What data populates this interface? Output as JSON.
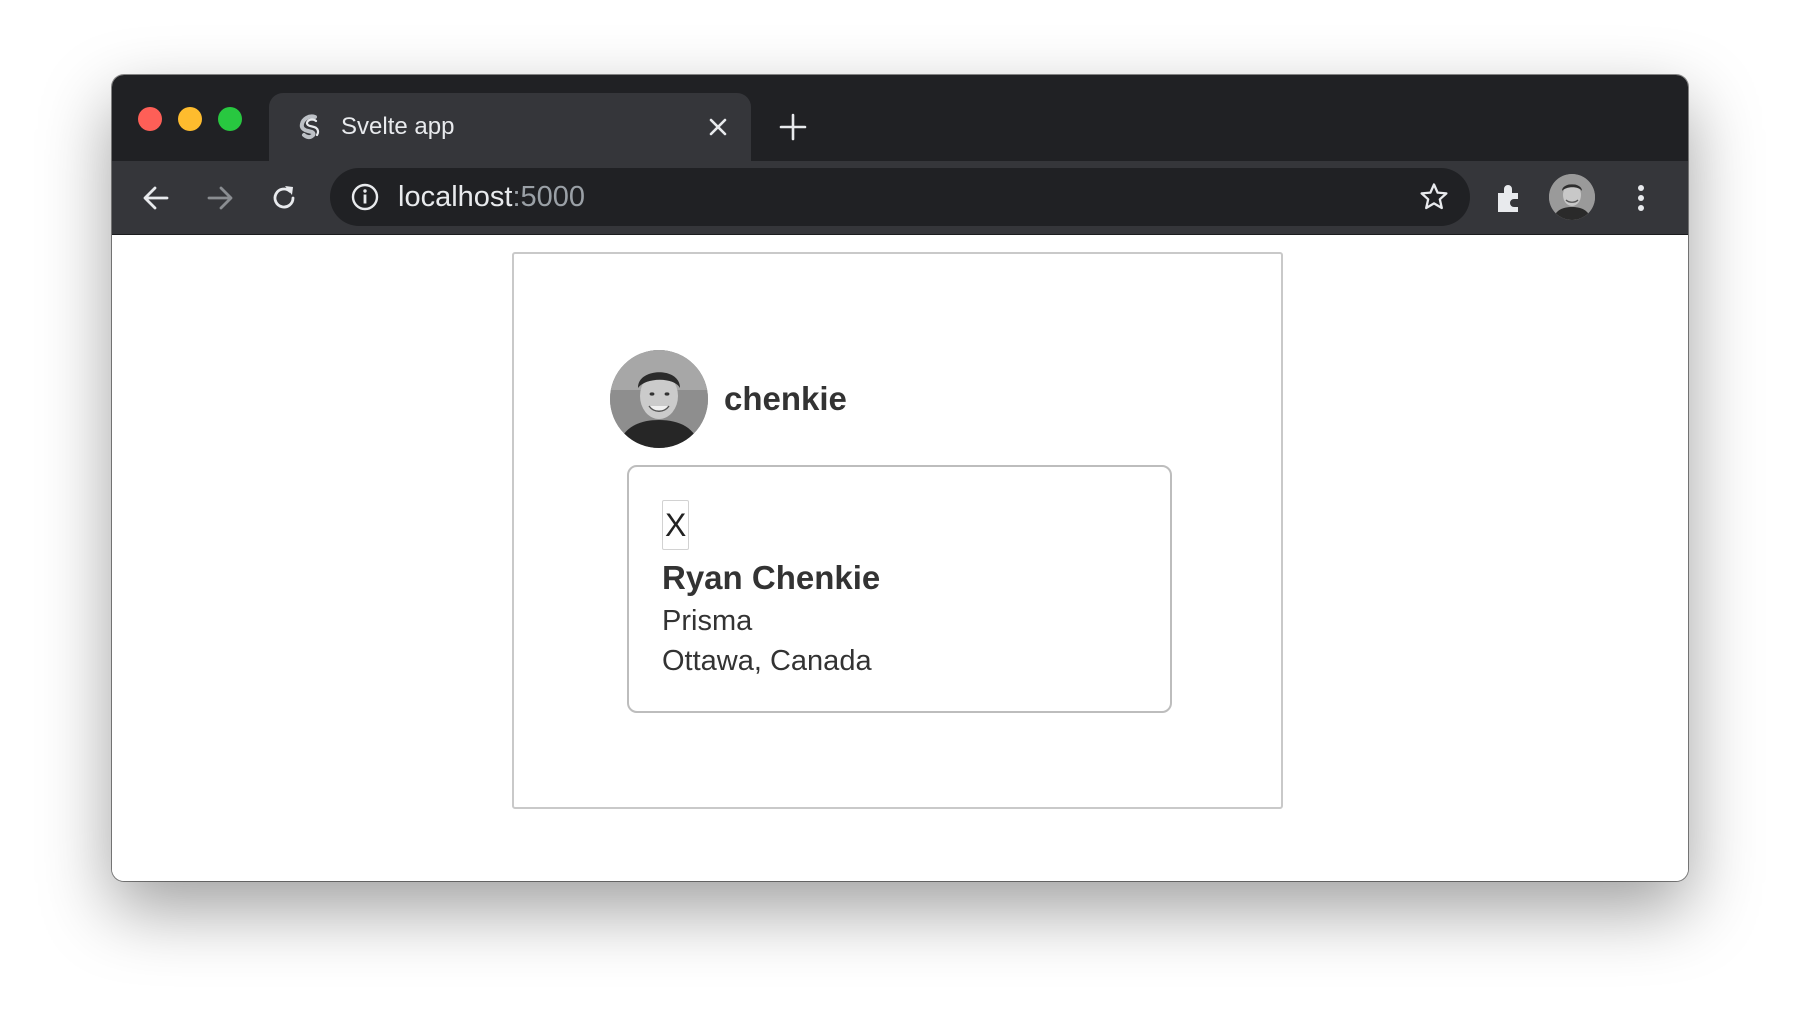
{
  "browser": {
    "tab": {
      "title": "Svelte app"
    },
    "address": {
      "host": "localhost",
      "port": ":5000"
    },
    "icons": {
      "favicon": "svelte-logo-icon",
      "close_tab": "close-icon",
      "new_tab": "plus-icon",
      "back": "arrow-left-icon",
      "forward": "arrow-right-icon",
      "reload": "reload-icon",
      "site_info": "info-icon",
      "bookmark": "star-icon",
      "extensions": "puzzle-icon",
      "menu": "more-vertical-icon"
    },
    "colors": {
      "tabstrip": "#202124",
      "toolbar": "#35363a",
      "omnibox": "#202124",
      "text": "#e8eaed",
      "muted_text": "#9aa0a6"
    }
  },
  "profile": {
    "username": "chenkie",
    "details": {
      "close_label": "X",
      "full_name": "Ryan Chenkie",
      "company": "Prisma",
      "location": "Ottawa, Canada"
    }
  }
}
